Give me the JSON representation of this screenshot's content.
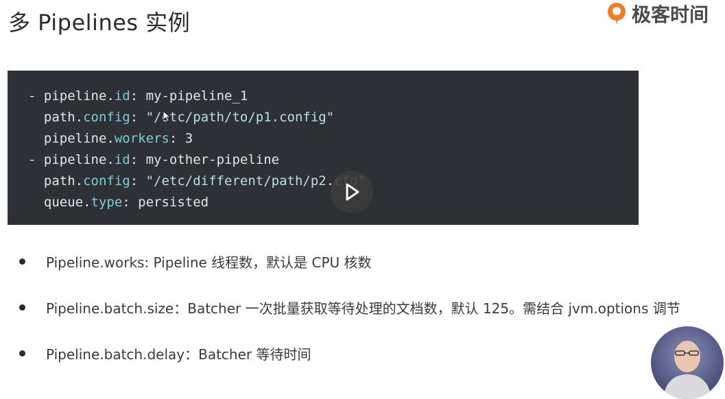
{
  "slide": {
    "title": "多 Pipelines 实例",
    "brand": "极客时间"
  },
  "code": {
    "lines": [
      [
        {
          "t": "- pipeline.",
          "c": ""
        },
        {
          "t": "id",
          "c": "k"
        },
        {
          "t": ": my-pipeline_1",
          "c": ""
        }
      ],
      [
        {
          "t": "  path.",
          "c": ""
        },
        {
          "t": "config",
          "c": "k"
        },
        {
          "t": ": ",
          "c": ""
        },
        {
          "t": "\"/etc/path/to/p1.config\"",
          "c": "s"
        }
      ],
      [
        {
          "t": "  pipeline.",
          "c": ""
        },
        {
          "t": "workers",
          "c": "k"
        },
        {
          "t": ": 3",
          "c": ""
        }
      ],
      [
        {
          "t": "- pipeline.",
          "c": ""
        },
        {
          "t": "id",
          "c": "k"
        },
        {
          "t": ": my-other-pipeline",
          "c": ""
        }
      ],
      [
        {
          "t": "  path.",
          "c": ""
        },
        {
          "t": "config",
          "c": "k"
        },
        {
          "t": ": ",
          "c": ""
        },
        {
          "t": "\"/etc/different/path/p2.cfg\"",
          "c": "s"
        }
      ],
      [
        {
          "t": "  queue.",
          "c": ""
        },
        {
          "t": "type",
          "c": "k"
        },
        {
          "t": ": persisted",
          "c": ""
        }
      ]
    ]
  },
  "bullets": [
    "Pipeline.works: Pipeline 线程数，默认是 CPU 核数",
    "Pipeline.batch.size：Batcher 一次批量获取等待处理的文档数，默认 125。需结合 jvm.options 调节",
    "Pipeline.batch.delay：Batcher 等待时间"
  ],
  "icons": {
    "play": "play-icon",
    "brand": "geektime-logo-icon",
    "cursor": "mouse-cursor-icon"
  },
  "colors": {
    "code_bg": "#2d3035",
    "code_key": "#7ad0d8",
    "brand_orange": "#f27c22"
  }
}
